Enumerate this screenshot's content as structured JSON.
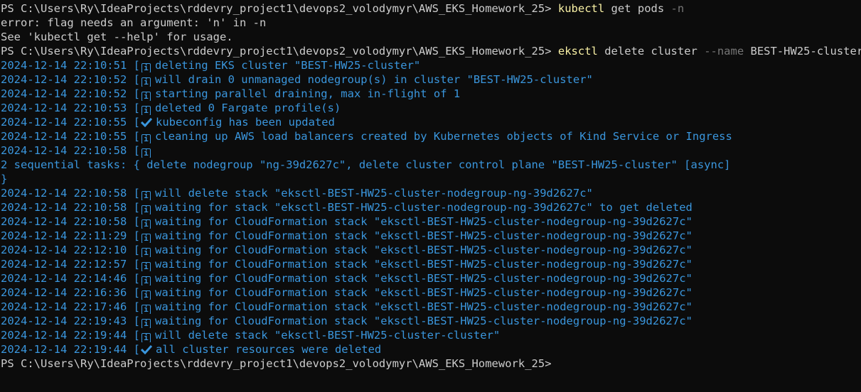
{
  "terminal": {
    "lines": [
      {
        "type": "prompt",
        "prompt": "PS C:\\Users\\Ry\\IdeaProjects\\rddevry_project1\\devops2_volodymyr\\AWS_EKS_Homework_25> ",
        "cmd": "kubectl",
        "args": " get pods ",
        "flag": "-n",
        "rest": ""
      },
      {
        "type": "plain",
        "text": "error: flag needs an argument: 'n' in -n"
      },
      {
        "type": "plain",
        "text": "See 'kubectl get --help' for usage."
      },
      {
        "type": "prompt",
        "prompt": "PS C:\\Users\\Ry\\IdeaProjects\\rddevry_project1\\devops2_volodymyr\\AWS_EKS_Homework_25> ",
        "cmd": "eksctl",
        "args": " delete cluster ",
        "flag": "--name",
        "rest": " BEST-HW25-cluster"
      },
      {
        "type": "log",
        "ts": "2024-12-14 22:10:51",
        "icon": "info",
        "msg": "deleting EKS cluster \"BEST-HW25-cluster\""
      },
      {
        "type": "log",
        "ts": "2024-12-14 22:10:52",
        "icon": "info",
        "msg": "will drain 0 unmanaged nodegroup(s) in cluster \"BEST-HW25-cluster\""
      },
      {
        "type": "log",
        "ts": "2024-12-14 22:10:52",
        "icon": "info",
        "msg": "starting parallel draining, max in-flight of 1"
      },
      {
        "type": "log",
        "ts": "2024-12-14 22:10:53",
        "icon": "info",
        "msg": "deleted 0 Fargate profile(s)"
      },
      {
        "type": "log",
        "ts": "2024-12-14 22:10:55",
        "icon": "check",
        "msg": "kubeconfig has been updated"
      },
      {
        "type": "log",
        "ts": "2024-12-14 22:10:55",
        "icon": "info",
        "msg": "cleaning up AWS load balancers created by Kubernetes objects of Kind Service or Ingress"
      },
      {
        "type": "log",
        "ts": "2024-12-14 22:10:58",
        "icon": "info",
        "msg": ""
      },
      {
        "type": "logtext",
        "text": "2 sequential tasks: { delete nodegroup \"ng-39d2627c\", delete cluster control plane \"BEST-HW25-cluster\" [async]"
      },
      {
        "type": "logtext",
        "text": "}"
      },
      {
        "type": "log",
        "ts": "2024-12-14 22:10:58",
        "icon": "info",
        "msg": "will delete stack \"eksctl-BEST-HW25-cluster-nodegroup-ng-39d2627c\""
      },
      {
        "type": "log",
        "ts": "2024-12-14 22:10:58",
        "icon": "info",
        "msg": "waiting for stack \"eksctl-BEST-HW25-cluster-nodegroup-ng-39d2627c\" to get deleted"
      },
      {
        "type": "log",
        "ts": "2024-12-14 22:10:58",
        "icon": "info",
        "msg": "waiting for CloudFormation stack \"eksctl-BEST-HW25-cluster-nodegroup-ng-39d2627c\""
      },
      {
        "type": "log",
        "ts": "2024-12-14 22:11:29",
        "icon": "info",
        "msg": "waiting for CloudFormation stack \"eksctl-BEST-HW25-cluster-nodegroup-ng-39d2627c\""
      },
      {
        "type": "log",
        "ts": "2024-12-14 22:12:10",
        "icon": "info",
        "msg": "waiting for CloudFormation stack \"eksctl-BEST-HW25-cluster-nodegroup-ng-39d2627c\""
      },
      {
        "type": "log",
        "ts": "2024-12-14 22:12:57",
        "icon": "info",
        "msg": "waiting for CloudFormation stack \"eksctl-BEST-HW25-cluster-nodegroup-ng-39d2627c\""
      },
      {
        "type": "log",
        "ts": "2024-12-14 22:14:46",
        "icon": "info",
        "msg": "waiting for CloudFormation stack \"eksctl-BEST-HW25-cluster-nodegroup-ng-39d2627c\""
      },
      {
        "type": "log",
        "ts": "2024-12-14 22:16:36",
        "icon": "info",
        "msg": "waiting for CloudFormation stack \"eksctl-BEST-HW25-cluster-nodegroup-ng-39d2627c\""
      },
      {
        "type": "log",
        "ts": "2024-12-14 22:17:46",
        "icon": "info",
        "msg": "waiting for CloudFormation stack \"eksctl-BEST-HW25-cluster-nodegroup-ng-39d2627c\""
      },
      {
        "type": "log",
        "ts": "2024-12-14 22:19:43",
        "icon": "info",
        "msg": "waiting for CloudFormation stack \"eksctl-BEST-HW25-cluster-nodegroup-ng-39d2627c\""
      },
      {
        "type": "log",
        "ts": "2024-12-14 22:19:44",
        "icon": "info",
        "msg": "will delete stack \"eksctl-BEST-HW25-cluster-cluster\""
      },
      {
        "type": "log",
        "ts": "2024-12-14 22:19:44",
        "icon": "check",
        "msg": "all cluster resources were deleted"
      },
      {
        "type": "prompt",
        "prompt": "PS C:\\Users\\Ry\\IdeaProjects\\rddevry_project1\\devops2_volodymyr\\AWS_EKS_Homework_25>",
        "cmd": "",
        "args": "",
        "flag": "",
        "rest": ""
      }
    ]
  },
  "colors": {
    "background": "#0c0c0c",
    "text": "#cccccc",
    "log": "#3a96dd",
    "command": "#f9f1a5",
    "flag": "#767676"
  }
}
